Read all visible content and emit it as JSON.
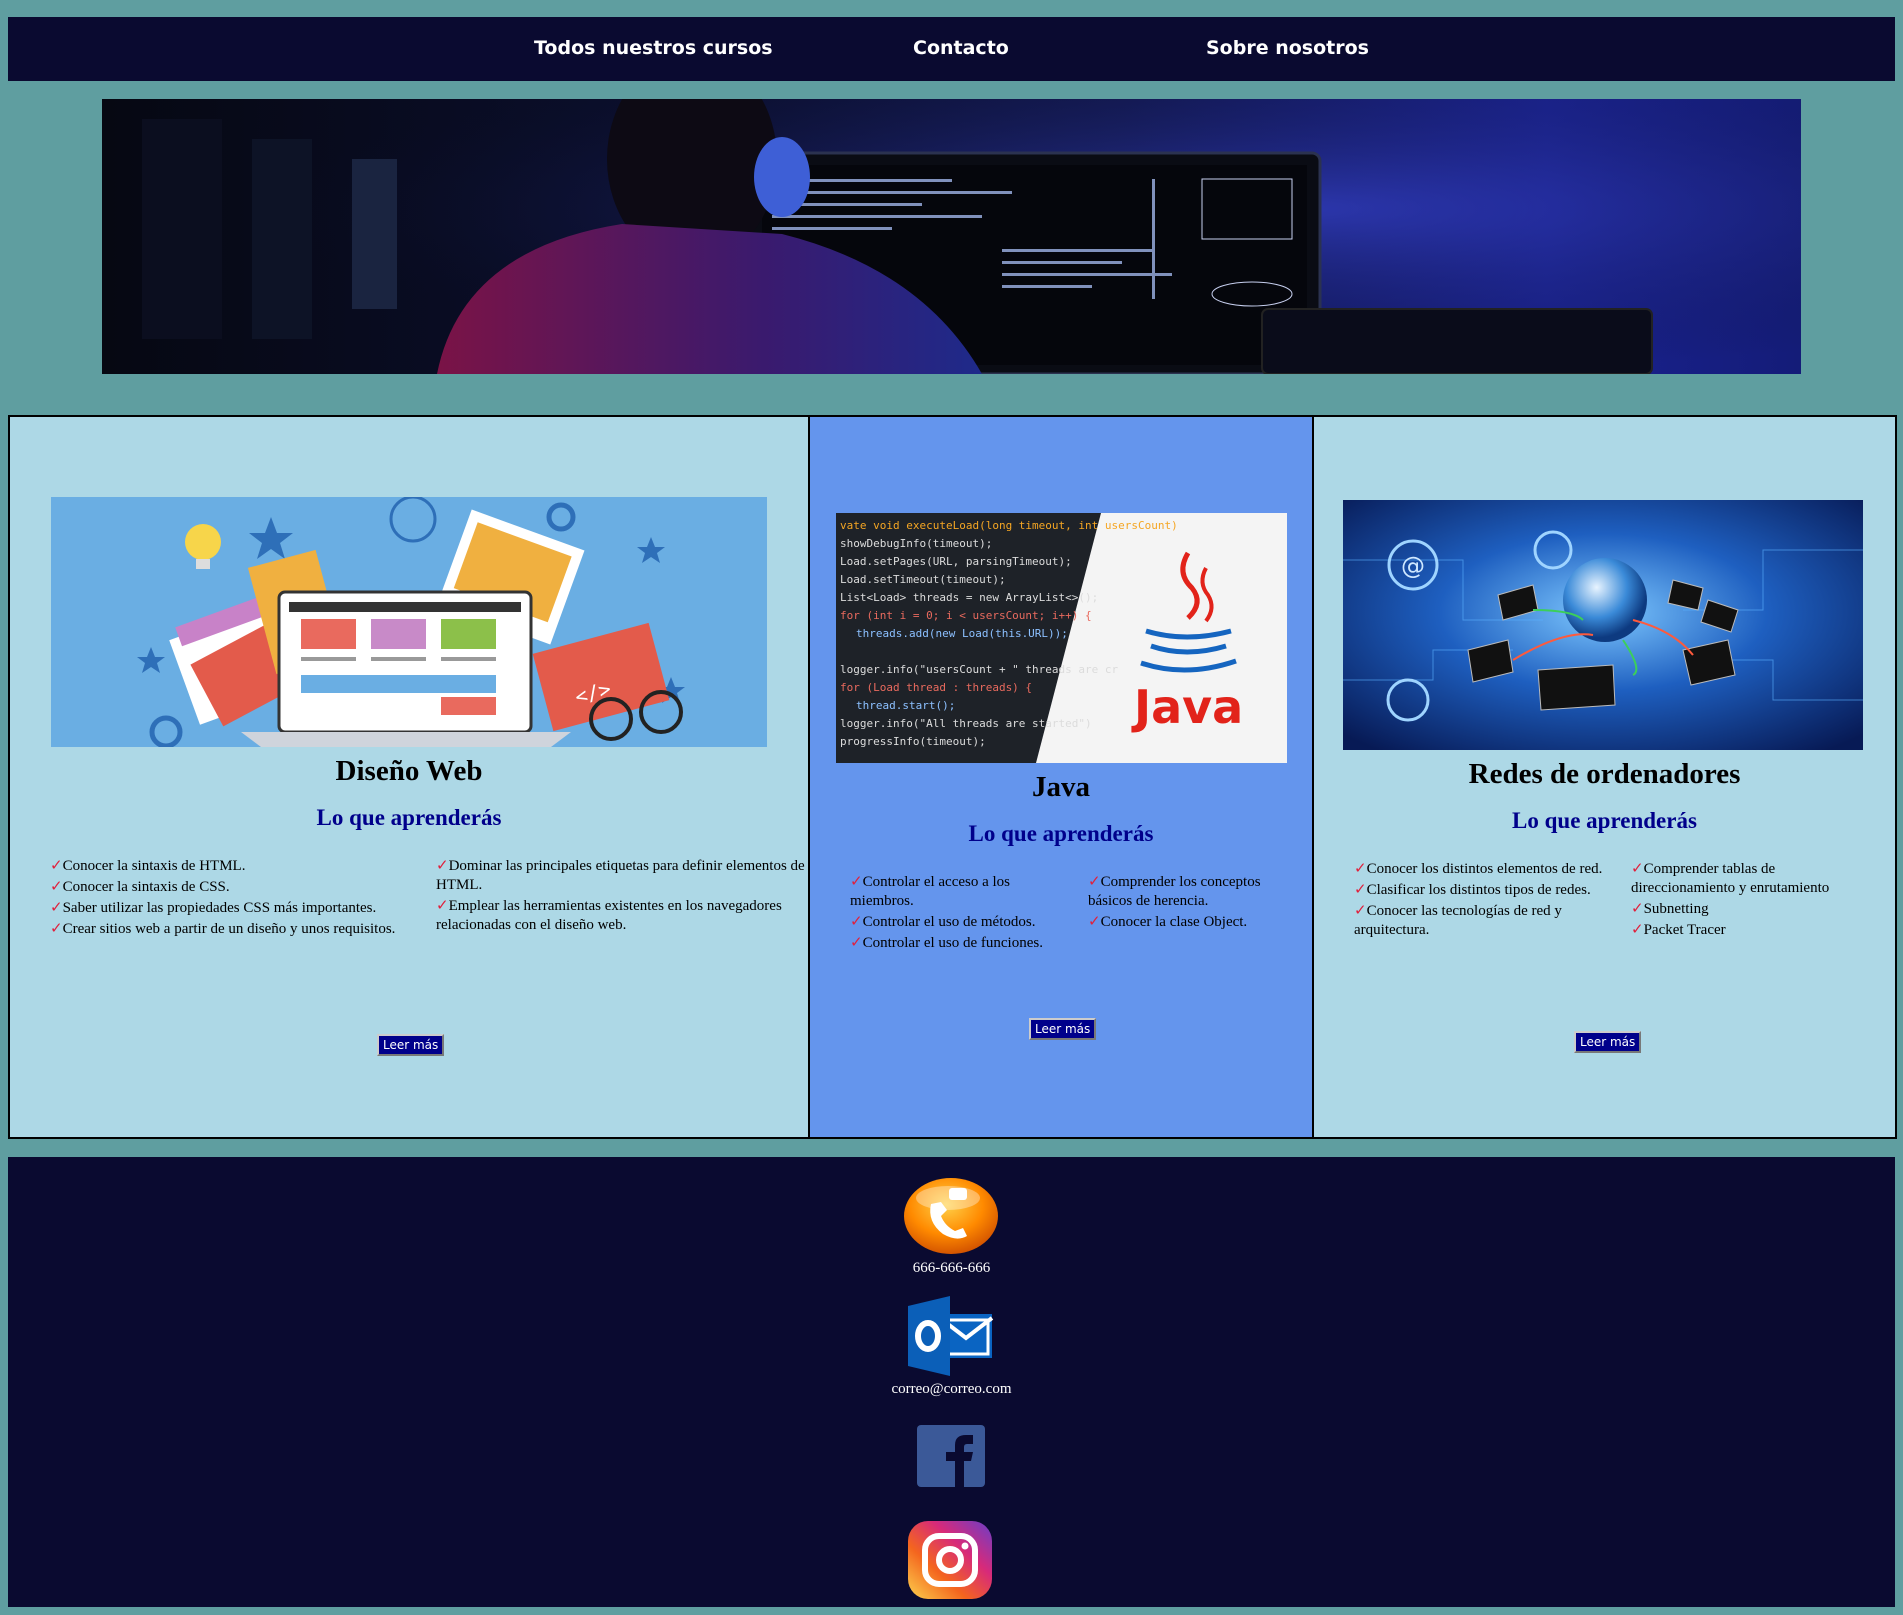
{
  "nav": {
    "items": [
      {
        "label": "Todos nuestros cursos"
      },
      {
        "label": "Contacto"
      },
      {
        "label": "Sobre nosotros"
      }
    ]
  },
  "hero": {
    "image": "programmer-at-monitor-image"
  },
  "courses": [
    {
      "title": "Diseño Web",
      "subtitle": "Lo que aprenderás",
      "image": "web-design-illustration",
      "col1": [
        "Conocer la sintaxis de HTML.",
        "Conocer la sintaxis de CSS.",
        "Saber utilizar las propiedades CSS más importantes.",
        "Crear sitios web a partir de un diseño y unos requisitos."
      ],
      "col2": [
        "Dominar las principales etiquetas para definir elementos de HTML.",
        "Emplear las herramientas existentes en los navegadores relacionadas con el diseño web."
      ],
      "button": "Leer más"
    },
    {
      "title": "Java",
      "subtitle": "Lo que aprenderás",
      "image": "java-code-logo",
      "logo_text": "Java",
      "col1": [
        "Controlar el acceso a los miembros.",
        "Controlar el uso de métodos.",
        "Controlar el uso de funciones."
      ],
      "col2": [
        "Comprender los conceptos básicos de herencia.",
        "Conocer la clase Object."
      ],
      "button": "Leer más"
    },
    {
      "title": "Redes de ordenadores",
      "subtitle": "Lo que aprenderás",
      "image": "network-laptops-globe",
      "col1": [
        "Conocer los distintos elementos de red.",
        "Clasificar los distintos tipos de redes.",
        "Conocer las tecnologías de red y arquitectura."
      ],
      "col2": [
        "Comprender tablas de direccionamiento y enrutamiento",
        "Subnetting",
        "Packet Tracer"
      ],
      "button": "Leer más"
    }
  ],
  "check": "✓",
  "footer": {
    "phone": "666-666-666",
    "email": "correo@correo.com",
    "icons": [
      "phone-icon",
      "outlook-icon",
      "facebook-icon",
      "instagram-icon"
    ]
  },
  "colors": {
    "background": "#5f9ea0",
    "nav": "#0a0a30",
    "card_light": "#add8e6",
    "card_blue": "#6495ed",
    "heading_blue": "#00008b",
    "check": "#e0203c"
  }
}
